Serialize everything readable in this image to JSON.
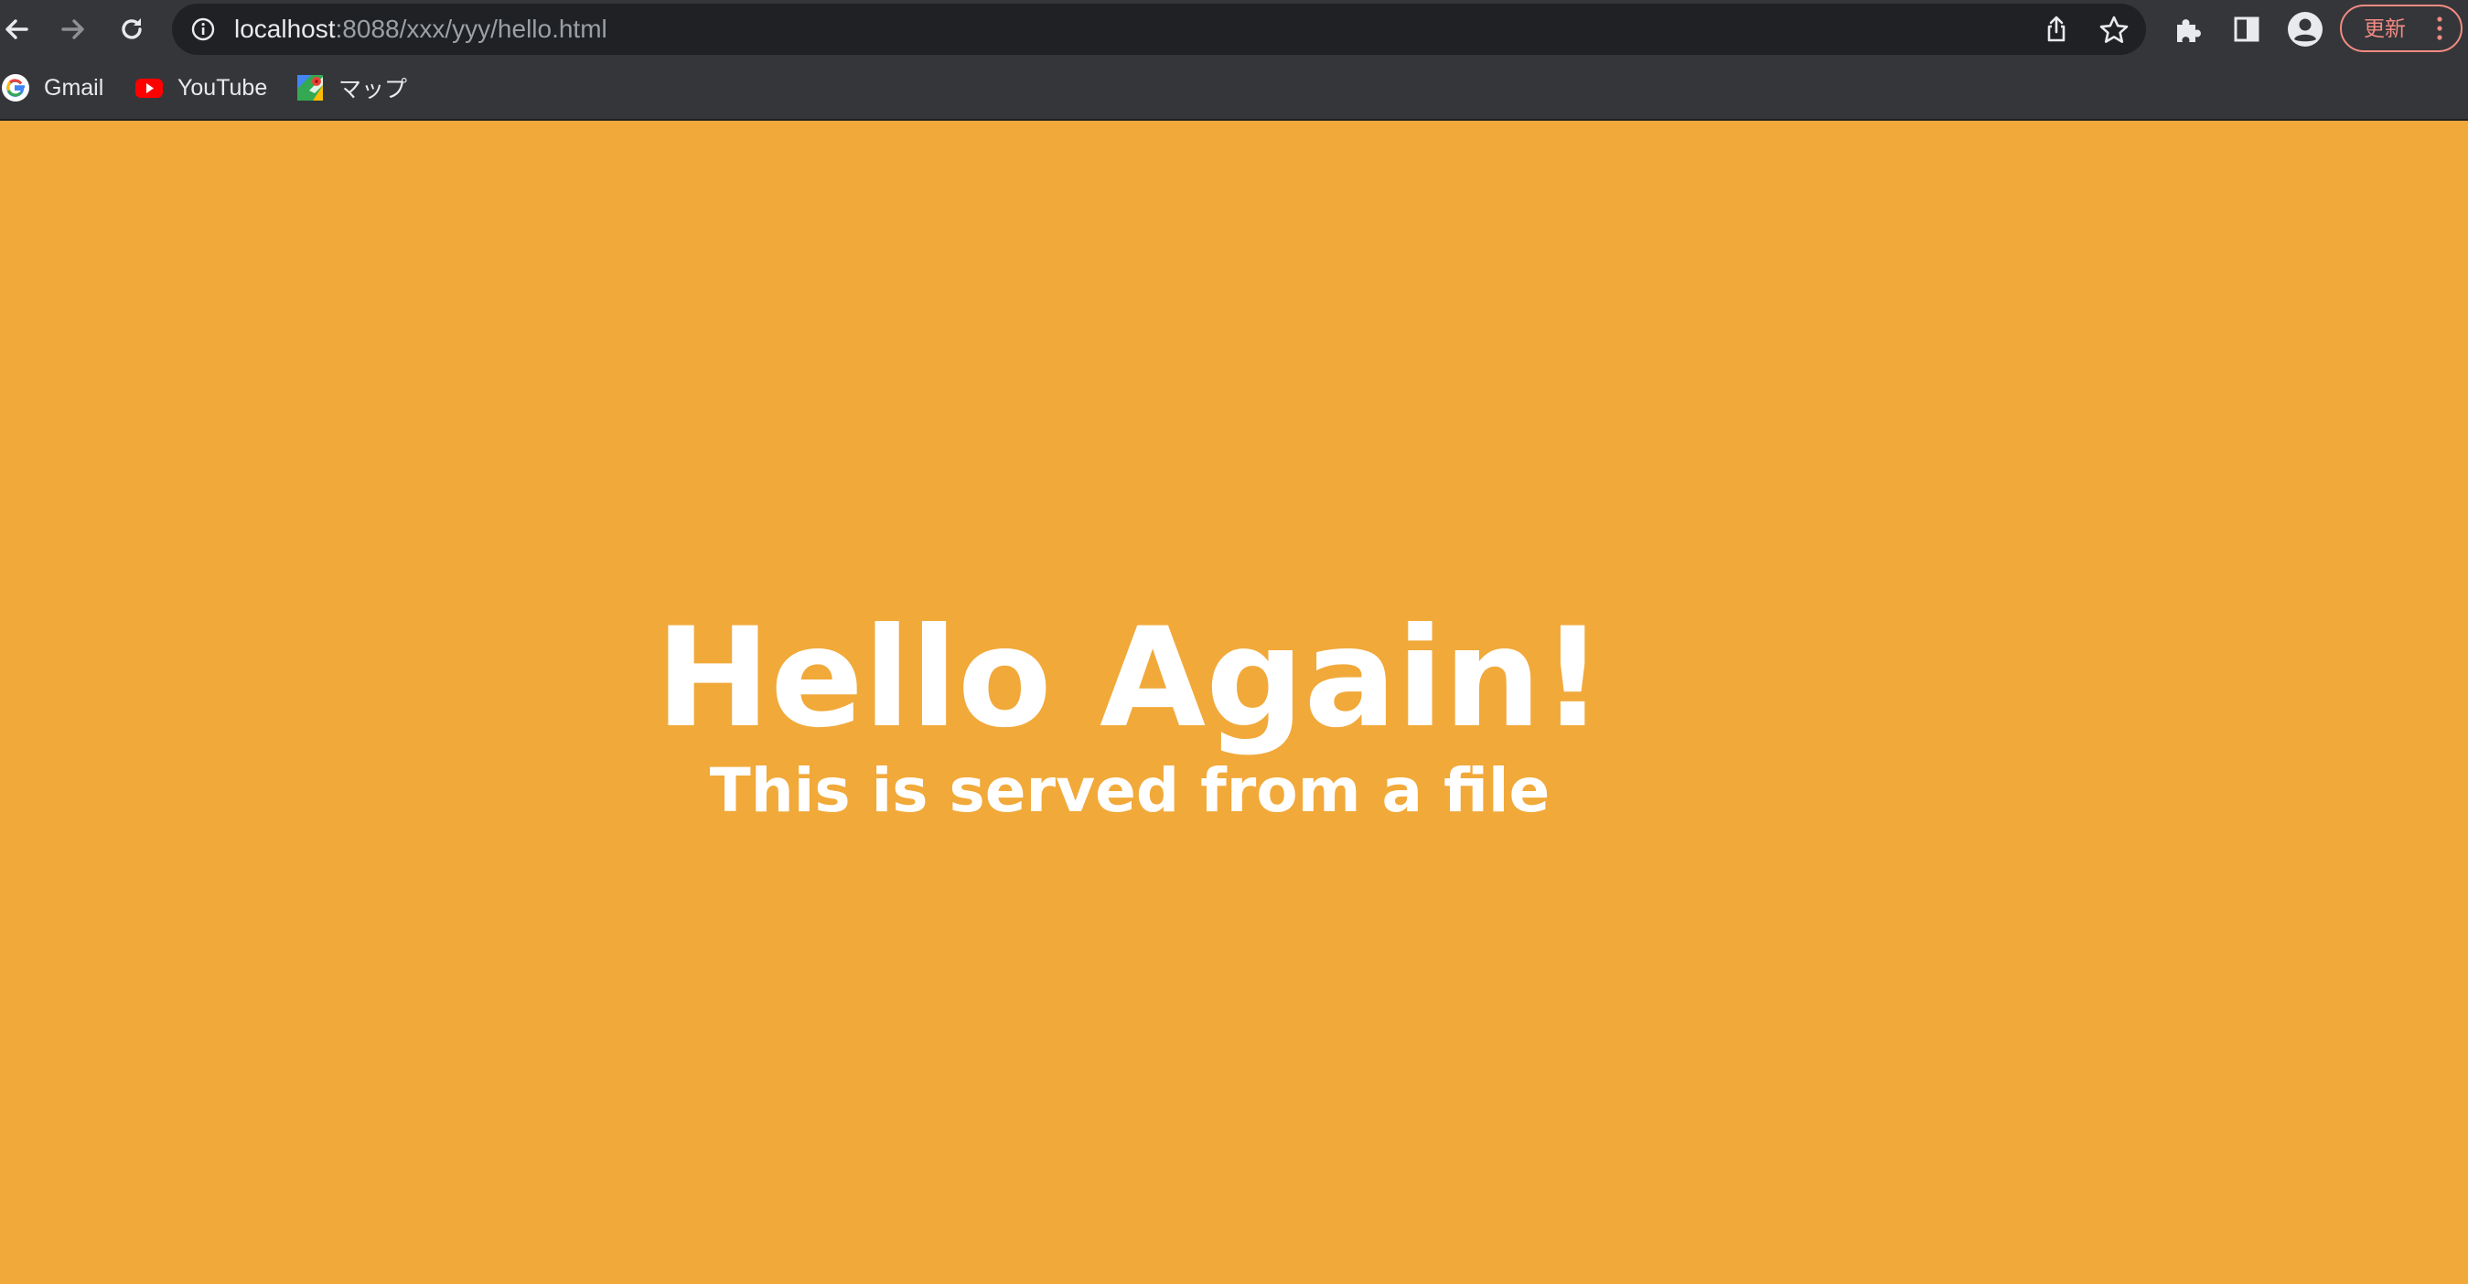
{
  "window": {
    "page_background": "#F1A93A",
    "toolbar_background": "#35363A",
    "accent_update": "#F28B82"
  },
  "toolbar": {
    "back_icon": "arrow-left-icon",
    "forward_icon": "arrow-right-icon",
    "reload_icon": "reload-icon",
    "extensions_icon": "puzzle-icon",
    "side_panel_icon": "side-panel-icon",
    "profile_icon": "profile-icon",
    "update_label": "更新",
    "menu_icon": "kebab-menu-icon"
  },
  "omnibox": {
    "site_info_icon": "info-icon",
    "url_host": "localhost",
    "url_rest": ":8088/xxx/yyy/hello.html",
    "share_icon": "share-icon",
    "bookmark_icon": "star-icon"
  },
  "bookmarks": [
    {
      "label": "Gmail",
      "icon": "google-icon"
    },
    {
      "label": "YouTube",
      "icon": "youtube-icon"
    },
    {
      "label": "マップ",
      "icon": "maps-icon"
    }
  ],
  "page": {
    "title": "Hello Again!",
    "subtitle": "This is served from a file"
  }
}
